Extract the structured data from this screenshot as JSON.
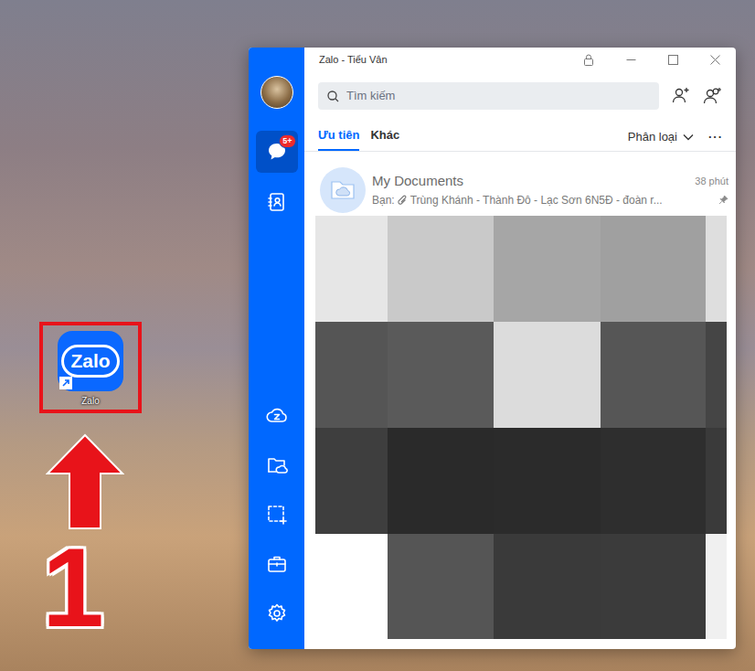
{
  "desktop": {
    "shortcut": {
      "logo": "Zalo",
      "label": "Zalo"
    },
    "step": "1"
  },
  "window": {
    "title": "Zalo - Tiểu Vân"
  },
  "sidebar": {
    "top_items": [
      {
        "selected": true,
        "badge": "5+"
      },
      {
        "selected": false
      }
    ],
    "bottom_items": [
      {
        "selected": false
      },
      {
        "selected": false
      },
      {
        "selected": false
      },
      {
        "selected": false
      },
      {
        "selected": false
      }
    ]
  },
  "search": {
    "placeholder": "Tìm kiếm"
  },
  "tabs": [
    {
      "label": "Ưu tiên",
      "selected": true
    },
    {
      "label": "Khác",
      "selected": false
    }
  ],
  "filter": {
    "label": "Phân loại",
    "more": "···"
  },
  "conversations": [
    {
      "name": "My Documents",
      "time": "38 phút",
      "sender": "Bạn:",
      "preview": "Trùng Khánh - Thành Đô - Lạc Sơn 6N5Đ - đoàn r...",
      "pinned": true
    }
  ]
}
